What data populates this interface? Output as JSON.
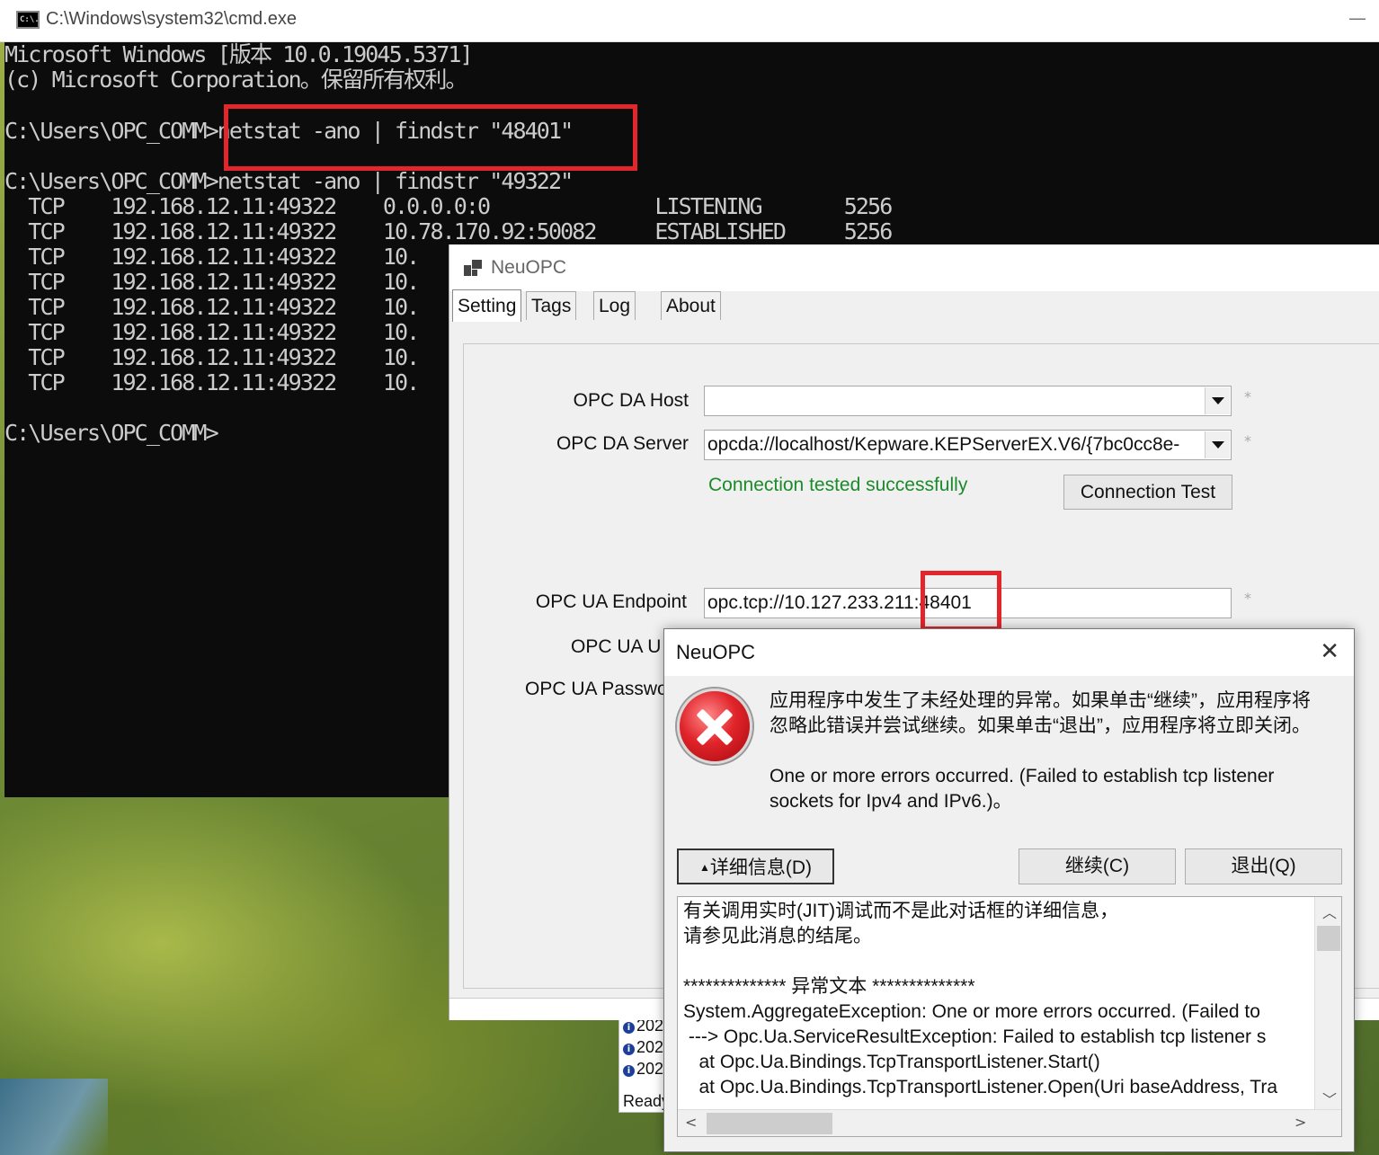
{
  "cmd": {
    "title": "C:\\Windows\\system32\\cmd.exe",
    "icon": "cmd-icon",
    "icon_text": "C:\\.",
    "minimize_glyph": "—",
    "lines": [
      "Microsoft Windows [版本 10.0.19045.5371]",
      "(c) Microsoft Corporation。保留所有权利。",
      "",
      "C:\\Users\\OPC_COMM>netstat -ano | findstr \"48401\"",
      "",
      "C:\\Users\\OPC_COMM>netstat -ano | findstr \"49322\"",
      "  TCP    192.168.12.11:49322    0.0.0.0:0              LISTENING       5256",
      "  TCP    192.168.12.11:49322    10.78.170.92:50082     ESTABLISHED     5256",
      "  TCP    192.168.12.11:49322    10.",
      "  TCP    192.168.12.11:49322    10.",
      "  TCP    192.168.12.11:49322    10.",
      "  TCP    192.168.12.11:49322    10.",
      "  TCP    192.168.12.11:49322    10.",
      "  TCP    192.168.12.11:49322    10.",
      "",
      "C:\\Users\\OPC_COMM>"
    ]
  },
  "neuopc": {
    "title": "NeuOPC",
    "tabs": [
      "Setting",
      "Tags",
      "Log",
      "About"
    ],
    "active_tab": "Setting",
    "opc_da_host_label": "OPC DA Host",
    "opc_da_host_value": "",
    "opc_da_server_label": "OPC DA Server",
    "opc_da_server_value": "opcda://localhost/Kepware.KEPServerEX.V6/{7bc0cc8e-",
    "connection_status": "Connection tested successfully",
    "connection_test_button": "Connection Test",
    "opc_ua_endpoint_label": "OPC UA Endpoint",
    "opc_ua_endpoint_value": "opc.tcp://10.127.233.211:48401",
    "opc_ua_user_label": "OPC UA U",
    "opc_ua_password_label": "OPC UA Passwo",
    "required_mark": "*",
    "status_color": "#1b8a2a"
  },
  "log_fragment": {
    "entries": [
      "202",
      "202",
      "202"
    ],
    "status": "Ready"
  },
  "error_dialog": {
    "title": "NeuOPC",
    "close_glyph": "✕",
    "message_cn_1": "应用程序中发生了未经处理的异常。如果单击“继续”，应用程序将",
    "message_cn_2": "忽略此错误并尝试继续。如果单击“退出”，应用程序将立即关闭。",
    "message_en_1": "One or more errors occurred. (Failed to establish tcp listener",
    "message_en_2": "sockets for Ipv4 and IPv6.)。",
    "details_button": "详细信息(D)",
    "continue_button": "继续(C)",
    "quit_button": "退出(Q)",
    "details_lines": [
      "有关调用实时(JIT)调试而不是此对话框的详细信息，",
      "请参见此消息的结尾。",
      "",
      "************** 异常文本 **************",
      "System.AggregateException: One or more errors occurred. (Failed to",
      " ---> Opc.Ua.ServiceResultException: Failed to establish tcp listener s",
      "   at Opc.Ua.Bindings.TcpTransportListener.Start()",
      "   at Opc.Ua.Bindings.TcpTransportListener.Open(Uri baseAddress, Tra"
    ],
    "icon": "error-icon",
    "accent": "#e3262b"
  }
}
